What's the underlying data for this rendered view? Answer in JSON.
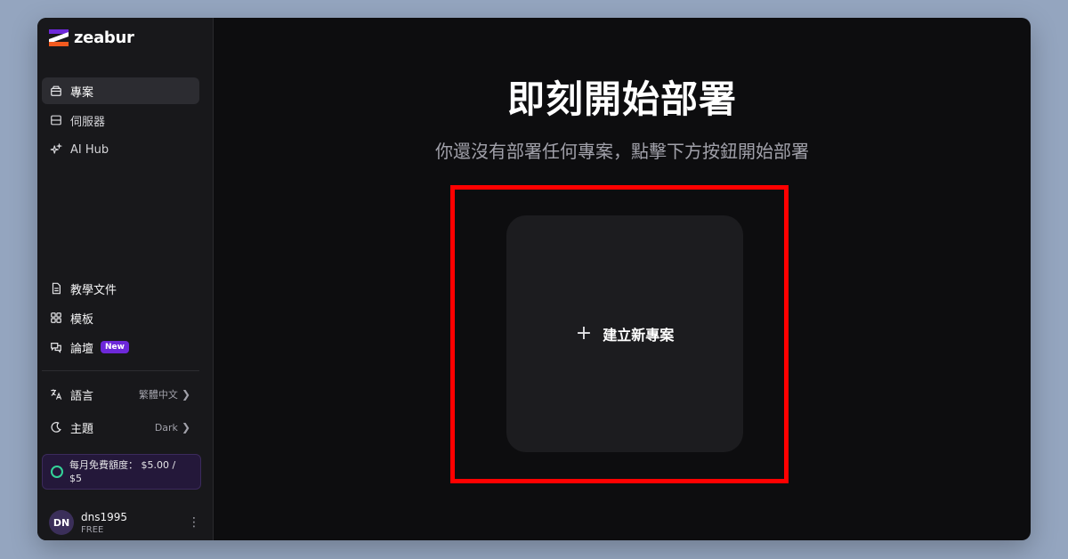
{
  "colors": {
    "background": "#94a5bf",
    "window": "#0d0d0f",
    "sidebar": "#18181b",
    "accent_purple": "#6d28d9",
    "highlight_red": "#ff0000",
    "quota_ring": "#34d399"
  },
  "logo": {
    "text": "zeabur"
  },
  "sidebar": {
    "top_items": [
      {
        "label": "專案",
        "icon": "folder-icon",
        "active": true
      },
      {
        "label": "伺服器",
        "icon": "server-icon",
        "active": false
      },
      {
        "label": "AI Hub",
        "icon": "sparkle-icon",
        "active": false
      }
    ],
    "bottom_items": [
      {
        "label": "教學文件",
        "icon": "document-icon"
      },
      {
        "label": "模板",
        "icon": "grid-icon"
      },
      {
        "label": "論壇",
        "icon": "chat-icon",
        "badge": "New"
      }
    ],
    "settings": {
      "language": {
        "label": "語言",
        "value": "繁體中文",
        "icon": "translate-icon"
      },
      "theme": {
        "label": "主題",
        "value": "Dark",
        "icon": "moon-icon"
      }
    },
    "quota": {
      "line1": "每月免費額度： $5.00 /",
      "line2": "$5"
    },
    "user": {
      "initials": "DN",
      "name": "dns1995",
      "plan": "FREE"
    }
  },
  "main": {
    "title": "即刻開始部署",
    "subtitle": "你還沒有部署任何專案，點擊下方按鈕開始部署",
    "create_button": {
      "icon": "plus-icon",
      "label": "建立新專案"
    }
  }
}
